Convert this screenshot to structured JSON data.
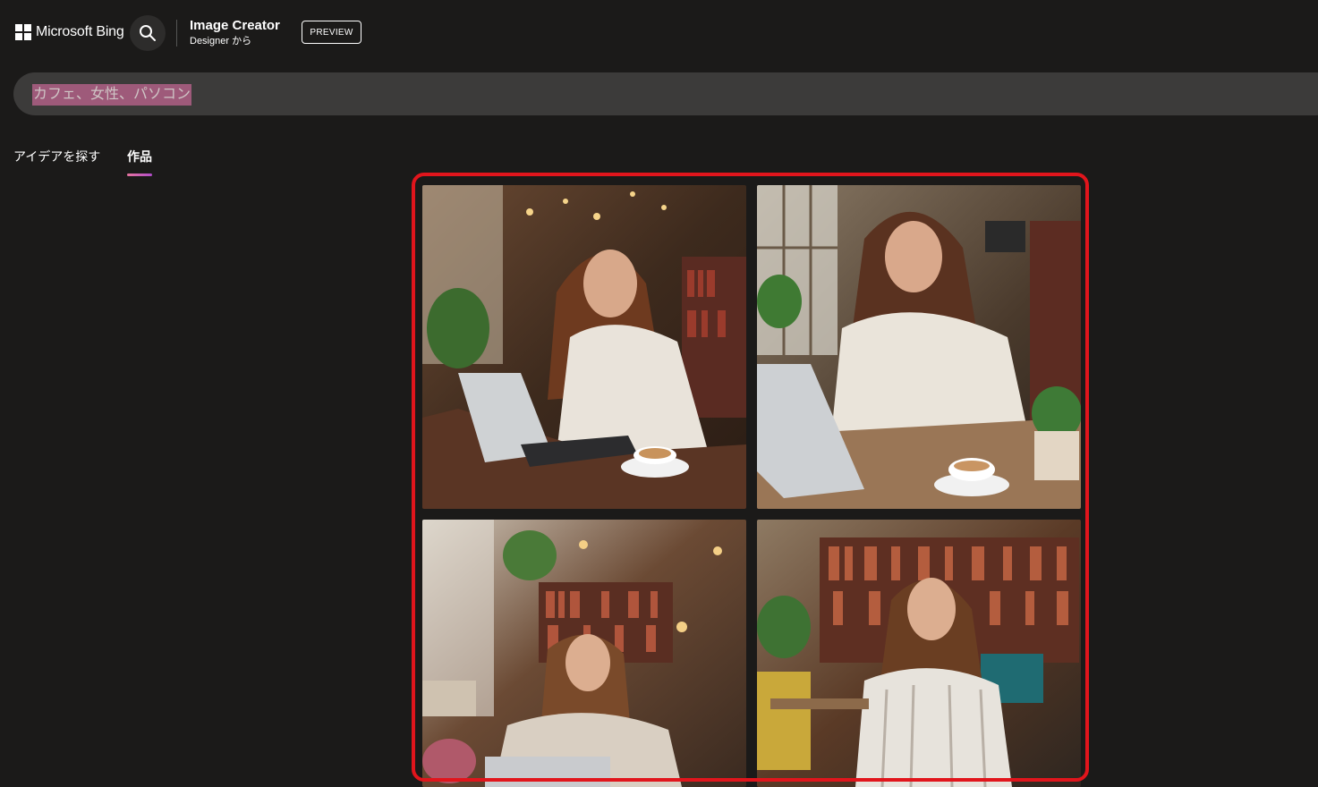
{
  "header": {
    "brand": "Microsoft Bing",
    "app_title": "Image Creator",
    "app_subtitle": "Designer から",
    "preview_badge": "PREVIEW",
    "search_icon": "search-icon"
  },
  "prompt": {
    "text": "カフェ、女性、パソコン"
  },
  "tabs": [
    {
      "label": "アイデアを探す",
      "active": false
    },
    {
      "label": "作品",
      "active": true
    }
  ],
  "colors": {
    "background": "#1b1a19",
    "highlight_frame": "#e1151c",
    "selection": "#9e5a7a",
    "tab_underline": "#d05fa8"
  },
  "gallery": {
    "images": [
      {
        "id": "image-1"
      },
      {
        "id": "image-2"
      },
      {
        "id": "image-3"
      },
      {
        "id": "image-4"
      }
    ]
  }
}
